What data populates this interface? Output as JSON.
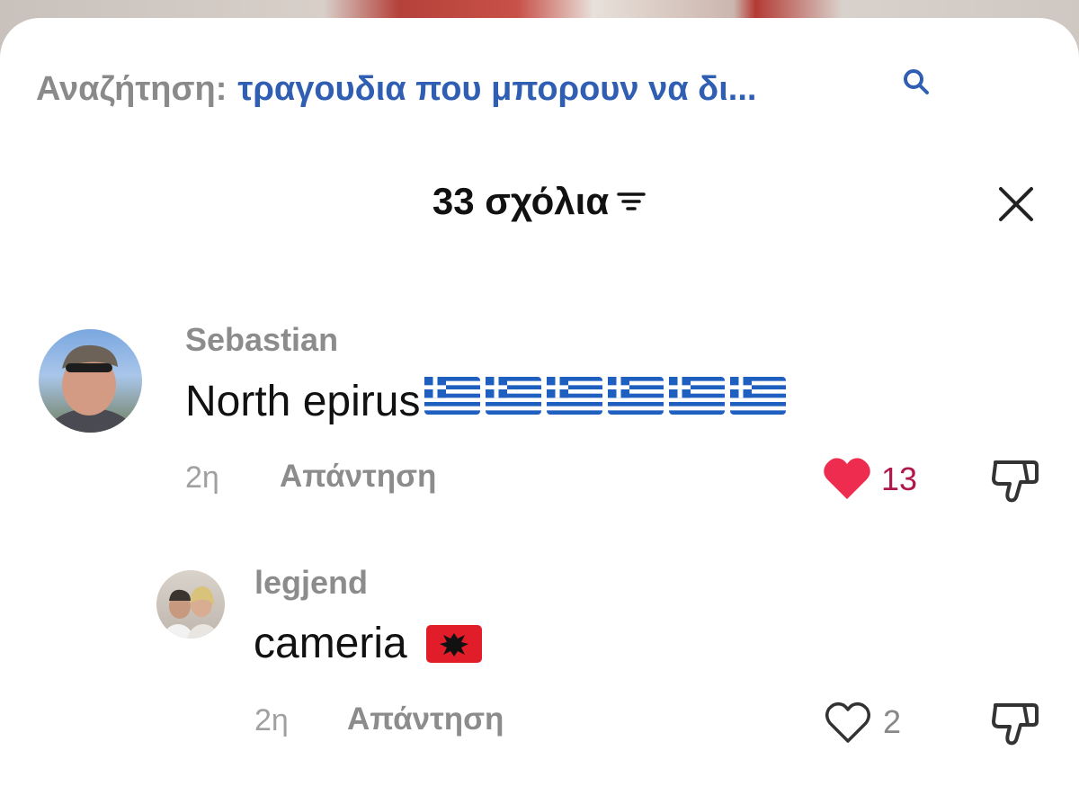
{
  "search": {
    "prefix": "Αναζήτηση:",
    "query": "τραγουδια που μπορουν να δι..."
  },
  "header": {
    "title": "33 σχόλια"
  },
  "comments": [
    {
      "username": "Sebastian",
      "text": "North epirus",
      "flag_count": 6,
      "time": "2η",
      "reply_label": "Απάντηση",
      "likes": "13",
      "liked": true
    },
    {
      "username": "legjend",
      "text": "cameria",
      "time": "2η",
      "reply_label": "Απάντηση",
      "likes": "2",
      "liked": false
    }
  ],
  "icons": {
    "search": "search-icon",
    "filter": "filter-icon",
    "close": "close-icon",
    "like": "heart-icon",
    "dislike": "thumbs-down-icon"
  },
  "colors": {
    "accent_blue": "#2f5eb3",
    "like_red": "#ee2c4f",
    "like_count_red": "#b0174a",
    "muted": "#8c8c8c"
  }
}
